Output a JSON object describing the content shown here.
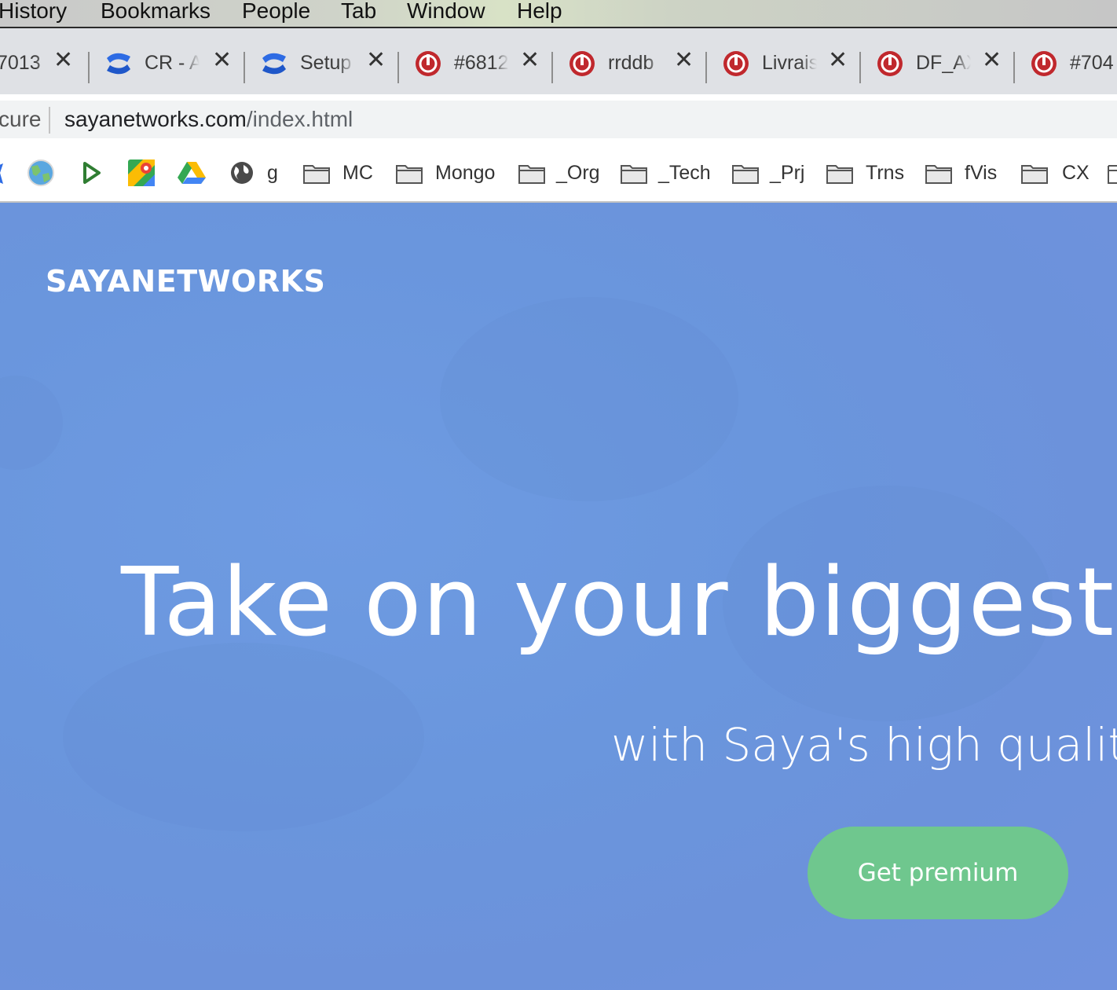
{
  "menubar": {
    "items": [
      "History",
      "Bookmarks",
      "People",
      "Tab",
      "Window",
      "Help"
    ]
  },
  "tabs": [
    {
      "title": "7013",
      "icon": "none"
    },
    {
      "title": "CR - A",
      "icon": "confluence-icon"
    },
    {
      "title": "Setup",
      "icon": "confluence-icon"
    },
    {
      "title": "#6812",
      "icon": "power-icon"
    },
    {
      "title": "rrddb",
      "icon": "power-icon"
    },
    {
      "title": "Livrais",
      "icon": "power-icon"
    },
    {
      "title": "DF_AX",
      "icon": "power-icon"
    },
    {
      "title": "#704",
      "icon": "power-icon"
    }
  ],
  "tab_close_glyph": "✕",
  "omnibox": {
    "security_text": "cure",
    "url_host": "sayanetworks.com",
    "url_path": "/index.html"
  },
  "bookmarks": [
    {
      "label": "",
      "icon": "globe-color-icon"
    },
    {
      "label": "",
      "icon": "play-icon"
    },
    {
      "label": "",
      "icon": "maps-icon"
    },
    {
      "label": "",
      "icon": "drive-icon"
    },
    {
      "label": "g",
      "icon": "globe-icon"
    },
    {
      "label": "MC",
      "icon": "folder-icon"
    },
    {
      "label": "Mongo",
      "icon": "folder-icon"
    },
    {
      "label": "_Org",
      "icon": "folder-icon"
    },
    {
      "label": "_Tech",
      "icon": "folder-icon"
    },
    {
      "label": "_Prj",
      "icon": "folder-icon"
    },
    {
      "label": "Trns",
      "icon": "folder-icon"
    },
    {
      "label": "fVis",
      "icon": "folder-icon"
    },
    {
      "label": "CX",
      "icon": "folder-icon"
    }
  ],
  "page": {
    "brand": "SAYANETWORKS",
    "headline": "Take on your biggest pro",
    "subline": "with Saya's high quality f",
    "cta_label": "Get premium"
  },
  "colors": {
    "page_background": "#6b96de",
    "cta_background": "#6fc78e",
    "power_icon_red": "#c0282d",
    "confluence_blue": "#2d6be4"
  }
}
